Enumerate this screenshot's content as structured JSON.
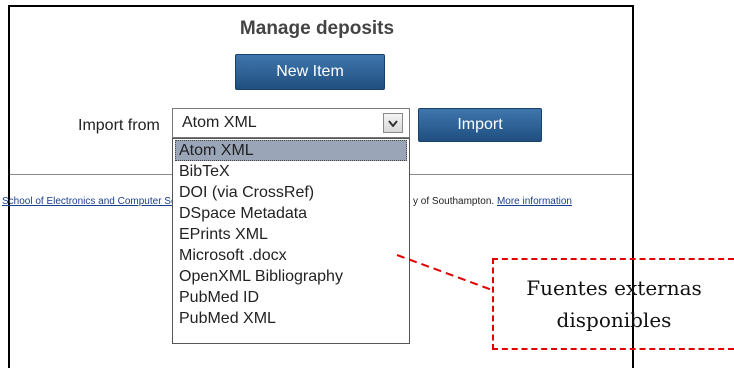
{
  "page_title": "Manage deposits",
  "new_item_label": "New Item",
  "import": {
    "label": "Import from",
    "selected": "Atom XML",
    "button_label": "Import",
    "options": [
      "Atom XML",
      "BibTeX",
      "DOI (via CrossRef)",
      "DSpace Metadata",
      "EPrints XML",
      "Microsoft .docx",
      "OpenXML Bibliography",
      "PubMed ID",
      "PubMed XML"
    ]
  },
  "footer": {
    "left_link": "School of Electronics and Computer Science",
    "right_text": "y of Southampton.",
    "more_info_link": "More information"
  },
  "callout": {
    "line1": "Fuentes externas",
    "line2": "disponibles",
    "color": "#e00000"
  }
}
